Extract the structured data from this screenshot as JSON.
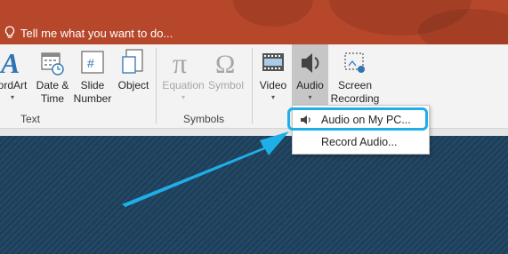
{
  "tellme": {
    "placeholder": "Tell me what you want to do..."
  },
  "ribbon": {
    "buttons": [
      {
        "label": "ordArt"
      },
      {
        "label": "Date &\nTime"
      },
      {
        "label": "Slide\nNumber"
      },
      {
        "label": "Object"
      },
      {
        "label": "Equation"
      },
      {
        "label": "Symbol"
      },
      {
        "label": "Video"
      },
      {
        "label": "Audio"
      },
      {
        "label": "Screen\nRecording"
      }
    ],
    "groups": {
      "text": "Text",
      "symbols": "Symbols"
    }
  },
  "dropdown": {
    "items": [
      {
        "label": "Audio on My PC..."
      },
      {
        "label": "Record Audio..."
      }
    ]
  },
  "colors": {
    "title_bar": "#b7472a",
    "slide": "#1c3f5b",
    "highlight": "#1faee8",
    "icon_blue": "#2e75b6"
  }
}
